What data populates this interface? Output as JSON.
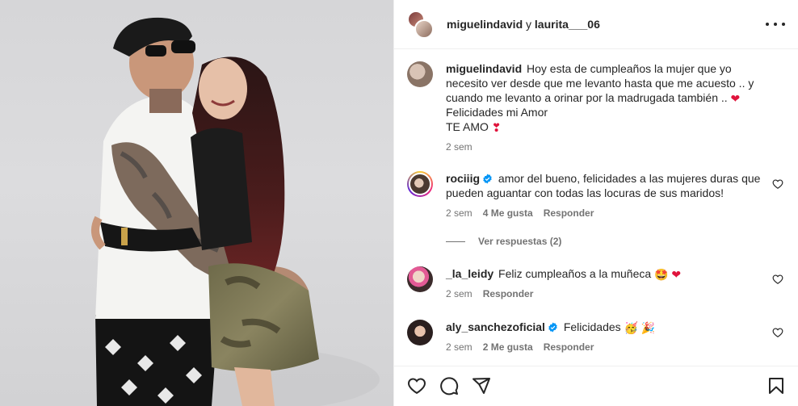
{
  "header": {
    "user1": "miguelindavid",
    "joiner": " y ",
    "user2": "laurita___06"
  },
  "caption": {
    "user": "miguelindavid",
    "text_part1": "Hoy esta de cumpleaños la mujer que yo necesito ver desde que me levanto hasta que me acuesto .. y cuando me levanto a orinar por la madrugada también .. ",
    "emoji1": "❤",
    "text_part2": " Felicidades mi Amor",
    "text_line2": "TE AMO ",
    "emoji2": "❣",
    "time": "2 sem"
  },
  "comments": [
    {
      "user": "rociiig",
      "verified": true,
      "text": "amor del bueno, felicidades a las mujeres duras que pueden aguantar con todas las locuras de sus maridos!",
      "time": "2 sem",
      "likes": "4 Me gusta",
      "reply": "Responder"
    },
    {
      "user": "_la_leidy",
      "verified": false,
      "text": "Feliz cumpleaños a la muñeca ",
      "emoji_a": "🤩",
      "emoji_b": "❤",
      "time": "2 sem",
      "reply": "Responder"
    },
    {
      "user": "aly_sanchezoficial",
      "verified": true,
      "text": "Felicidades ",
      "emoji_a": "🥳",
      "emoji_b": "🎉",
      "time": "2 sem",
      "likes": "2 Me gusta",
      "reply": "Responder"
    }
  ],
  "replies_toggle": "Ver respuestas (2)",
  "icons": {
    "like": "heart-icon",
    "comment": "comment-icon",
    "share": "share-icon",
    "save": "bookmark-icon",
    "more": "more-options-icon"
  },
  "colors": {
    "verified": "#0095f6",
    "heart": "#e0143c",
    "muted": "#737373",
    "text": "#262626"
  }
}
